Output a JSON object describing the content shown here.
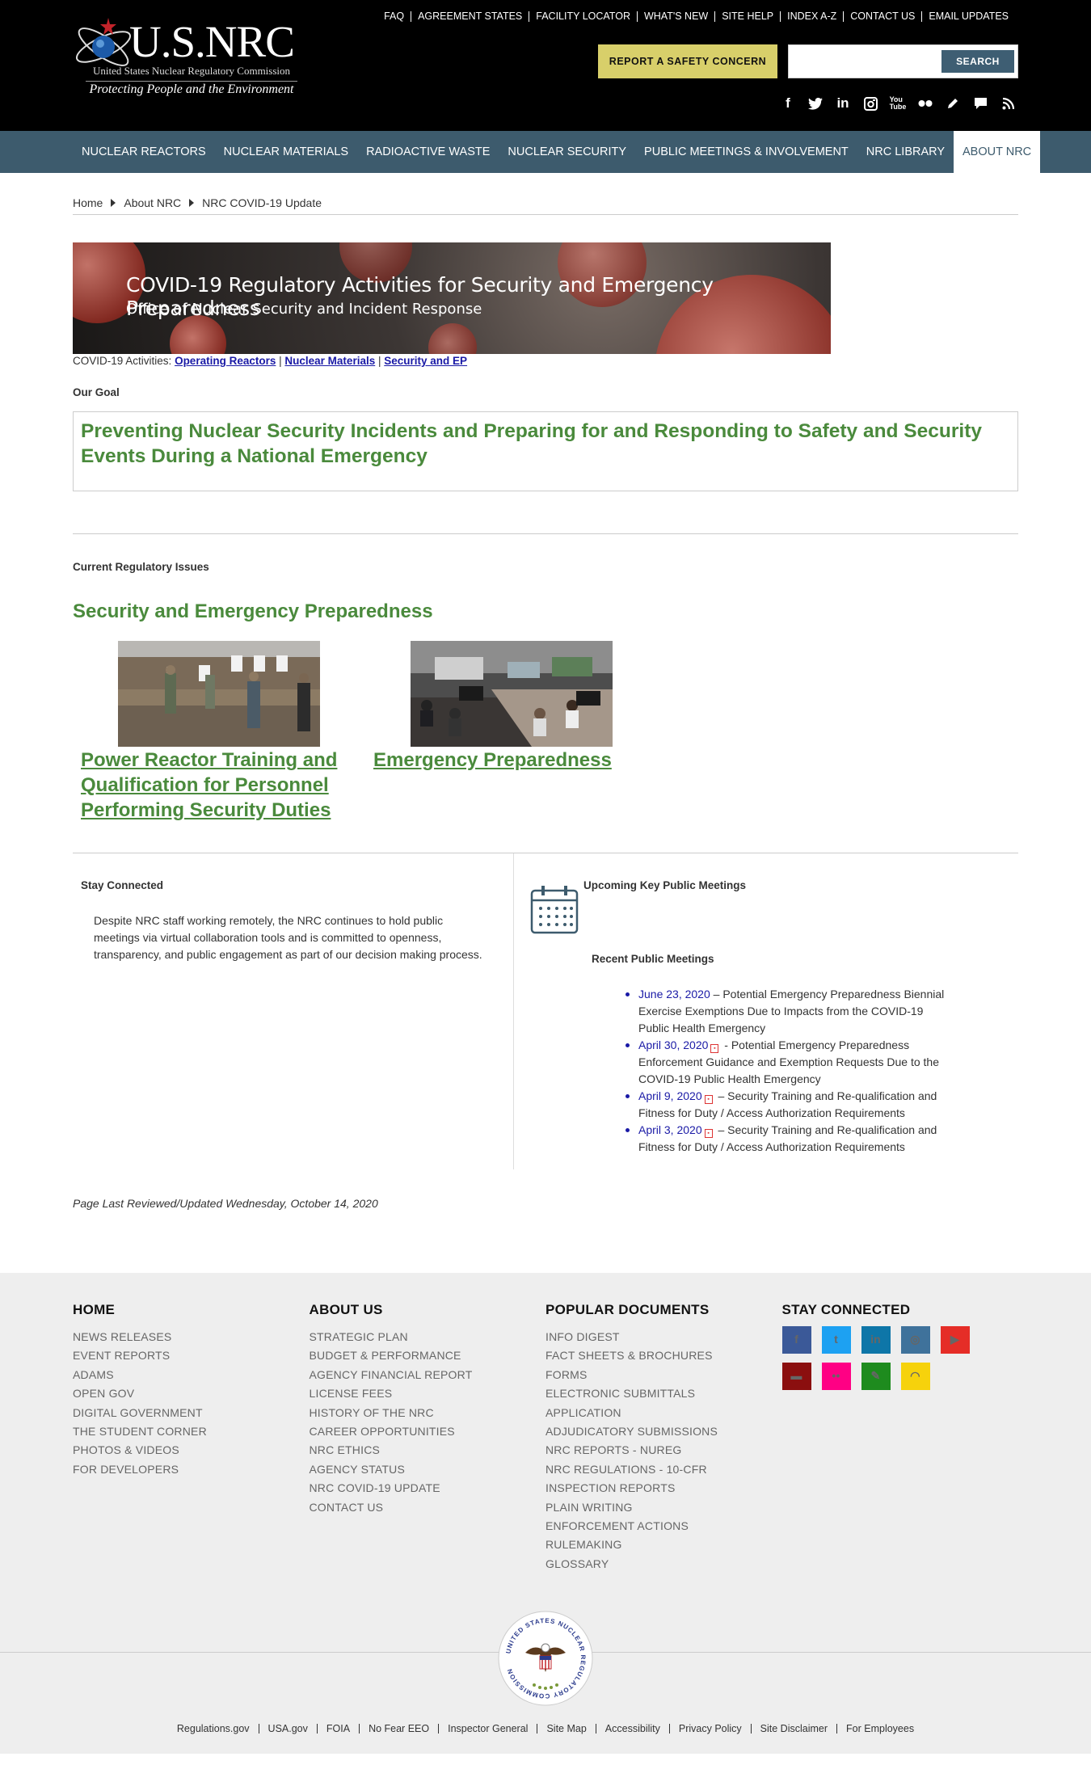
{
  "header": {
    "logo_text": "U.S.NRC",
    "logo_sub": "United States Nuclear Regulatory Commission",
    "logo_tag": "Protecting People and the Environment",
    "top_links": [
      "FAQ",
      "AGREEMENT STATES",
      "FACILITY LOCATOR",
      "WHAT'S NEW",
      "SITE HELP",
      "INDEX A-Z",
      "CONTACT US",
      "EMAIL UPDATES"
    ],
    "report_button": "REPORT A SAFETY CONCERN",
    "search_placeholder": "",
    "search_button": "SEARCH",
    "social_icons": [
      "facebook-icon",
      "twitter-icon",
      "linkedin-icon",
      "instagram-icon",
      "youtube-icon",
      "flickr-icon",
      "blog-icon",
      "comment-icon",
      "rss-icon"
    ]
  },
  "nav": {
    "items": [
      "NUCLEAR REACTORS",
      "NUCLEAR MATERIALS",
      "RADIOACTIVE WASTE",
      "NUCLEAR SECURITY",
      "PUBLIC MEETINGS & INVOLVEMENT",
      "NRC LIBRARY",
      "ABOUT NRC"
    ],
    "active": "ABOUT NRC"
  },
  "breadcrumb": [
    "Home",
    "About NRC",
    "NRC COVID-19 Update"
  ],
  "banner": {
    "title": "COVID-19 Regulatory Activities for Security and Emergency Preparedness",
    "subtitle": "Office of Nuclear Security and Incident Response"
  },
  "activities": {
    "label": "COVID-19 Activities:",
    "links": [
      "Operating Reactors",
      "Nuclear Materials",
      "Security and EP"
    ],
    "separator": "|"
  },
  "goal": {
    "heading": "Our Goal",
    "text": "Preventing Nuclear Security Incidents and Preparing for and Responding to Safety and Security Events During a National Emergency"
  },
  "issues": {
    "heading": "Current Regulatory Issues",
    "title": "Security and Emergency Preparedness",
    "cards": [
      {
        "label": "Power Reactor Training and Qualification for Personnel Performing Security Duties"
      },
      {
        "label": "Emergency Preparedness"
      }
    ]
  },
  "stay": {
    "heading": "Stay Connected",
    "text": "Despite NRC staff working remotely, the NRC continues to hold public meetings via virtual collaboration tools and is committed to openness, transparency, and public engagement as part of our decision making process."
  },
  "meetings": {
    "upcoming_heading": "Upcoming Key Public Meetings",
    "recent_heading": "Recent Public Meetings",
    "items": [
      {
        "date": "June 23, 2020",
        "pdf": false,
        "text": " – Potential Emergency Preparedness Biennial Exercise Exemptions Due to Impacts from the COVID-19 Public Health Emergency"
      },
      {
        "date": "April 30, 2020",
        "pdf": true,
        "text": " - Potential Emergency Preparedness Enforcement Guidance and Exemption Requests Due to the COVID-19 Public Health Emergency"
      },
      {
        "date": "April 9, 2020",
        "pdf": true,
        "text": " – Security Training and Re-qualification and Fitness for Duty / Access Authorization Requirements"
      },
      {
        "date": "April 3, 2020",
        "pdf": true,
        "text": " – Security Training and Re-qualification and Fitness for Duty / Access Authorization Requirements"
      }
    ]
  },
  "reviewed": "Page Last Reviewed/Updated Wednesday, October 14, 2020",
  "footer": {
    "columns": [
      {
        "title": "HOME",
        "links": [
          "NEWS RELEASES",
          "EVENT REPORTS",
          "ADAMS",
          "OPEN GOV",
          "DIGITAL GOVERNMENT",
          "THE STUDENT CORNER",
          "PHOTOS & VIDEOS",
          "FOR DEVELOPERS"
        ]
      },
      {
        "title": "ABOUT US",
        "links": [
          "STRATEGIC PLAN",
          "BUDGET & PERFORMANCE",
          "AGENCY FINANCIAL REPORT",
          "LICENSE FEES",
          "HISTORY OF THE NRC",
          "CAREER OPPORTUNITIES",
          "NRC ETHICS",
          "AGENCY STATUS",
          "NRC COVID-19 UPDATE",
          "CONTACT US"
        ]
      },
      {
        "title": "POPULAR DOCUMENTS",
        "links": [
          "INFO DIGEST",
          "FACT SHEETS & BROCHURES",
          "FORMS",
          "ELECTRONIC SUBMITTALS",
          "APPLICATION",
          "ADJUDICATORY SUBMISSIONS",
          "NRC REPORTS - NUREG",
          "NRC REGULATIONS - 10-CFR",
          "INSPECTION REPORTS",
          "PLAIN WRITING",
          "ENFORCEMENT ACTIONS",
          "RULEMAKING",
          "GLOSSARY"
        ]
      }
    ],
    "stay_title": "STAY CONNECTED",
    "social": [
      {
        "icon": "facebook-icon",
        "glyph": "f",
        "color": "#3b5998"
      },
      {
        "icon": "twitter-icon",
        "glyph": "t",
        "color": "#1da1f2"
      },
      {
        "icon": "linkedin-icon",
        "glyph": "in",
        "color": "#0e76a8"
      },
      {
        "icon": "instagram-icon",
        "glyph": "◎",
        "color": "#3f729b"
      },
      {
        "icon": "youtube-icon",
        "glyph": "▶",
        "color": "#e52d27"
      },
      {
        "icon": "comment-icon",
        "glyph": "▬",
        "color": "#8b0f0f"
      },
      {
        "icon": "flickr-icon",
        "glyph": "••",
        "color": "#ff0084"
      },
      {
        "icon": "blog-icon",
        "glyph": "✎",
        "color": "#1e8b1e"
      },
      {
        "icon": "rss-icon",
        "glyph": "◠",
        "color": "#f6d20c"
      }
    ],
    "seal_text": "UNITED STATES NUCLEAR REGULATORY COMMISSION",
    "bottom_links": [
      "Regulations.gov",
      "USA.gov",
      "FOIA",
      "No Fear EEO",
      "Inspector General",
      "Site Map",
      "Accessibility",
      "Privacy Policy",
      "Site Disclaimer",
      "For Employees"
    ]
  },
  "colors": {
    "nav_bg": "#3d5b6d",
    "green": "#4a8a3c",
    "link": "#1a1aa6",
    "report_btn": "#d8cf6a"
  }
}
